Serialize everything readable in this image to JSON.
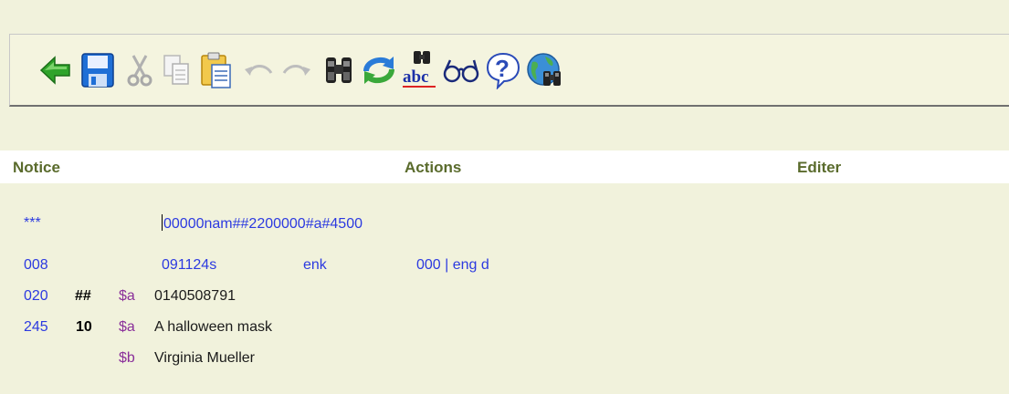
{
  "toolbar": {
    "buttons": [
      {
        "name": "back-arrow-icon"
      },
      {
        "name": "save-icon"
      },
      {
        "name": "cut-icon"
      },
      {
        "name": "copy-icon"
      },
      {
        "name": "paste-icon"
      },
      {
        "name": "undo-icon"
      },
      {
        "name": "redo-icon"
      },
      {
        "name": "search-binoculars-icon"
      },
      {
        "name": "refresh-icon"
      },
      {
        "name": "spellcheck-icon"
      },
      {
        "name": "glasses-icon"
      },
      {
        "name": "help-icon"
      },
      {
        "name": "globe-search-icon"
      }
    ],
    "spell_label": "abc",
    "help_glyph": "?"
  },
  "header": {
    "notice": "Notice",
    "actions": "Actions",
    "editer": "Editer"
  },
  "record": {
    "leader": {
      "tag": "***",
      "value": "00000nam##2200000#a#4500"
    },
    "f008": {
      "tag": "008",
      "part1": "091124s",
      "part2": "enk",
      "part3": "000 | eng d"
    },
    "f020": {
      "tag": "020",
      "ind": "##",
      "sub": "$a",
      "value": "0140508791"
    },
    "f245": {
      "tag": "245",
      "ind": "10",
      "sub": "$a",
      "value": "A halloween mask"
    },
    "f245b": {
      "sub": "$b",
      "value": "Virginia Mueller"
    }
  }
}
